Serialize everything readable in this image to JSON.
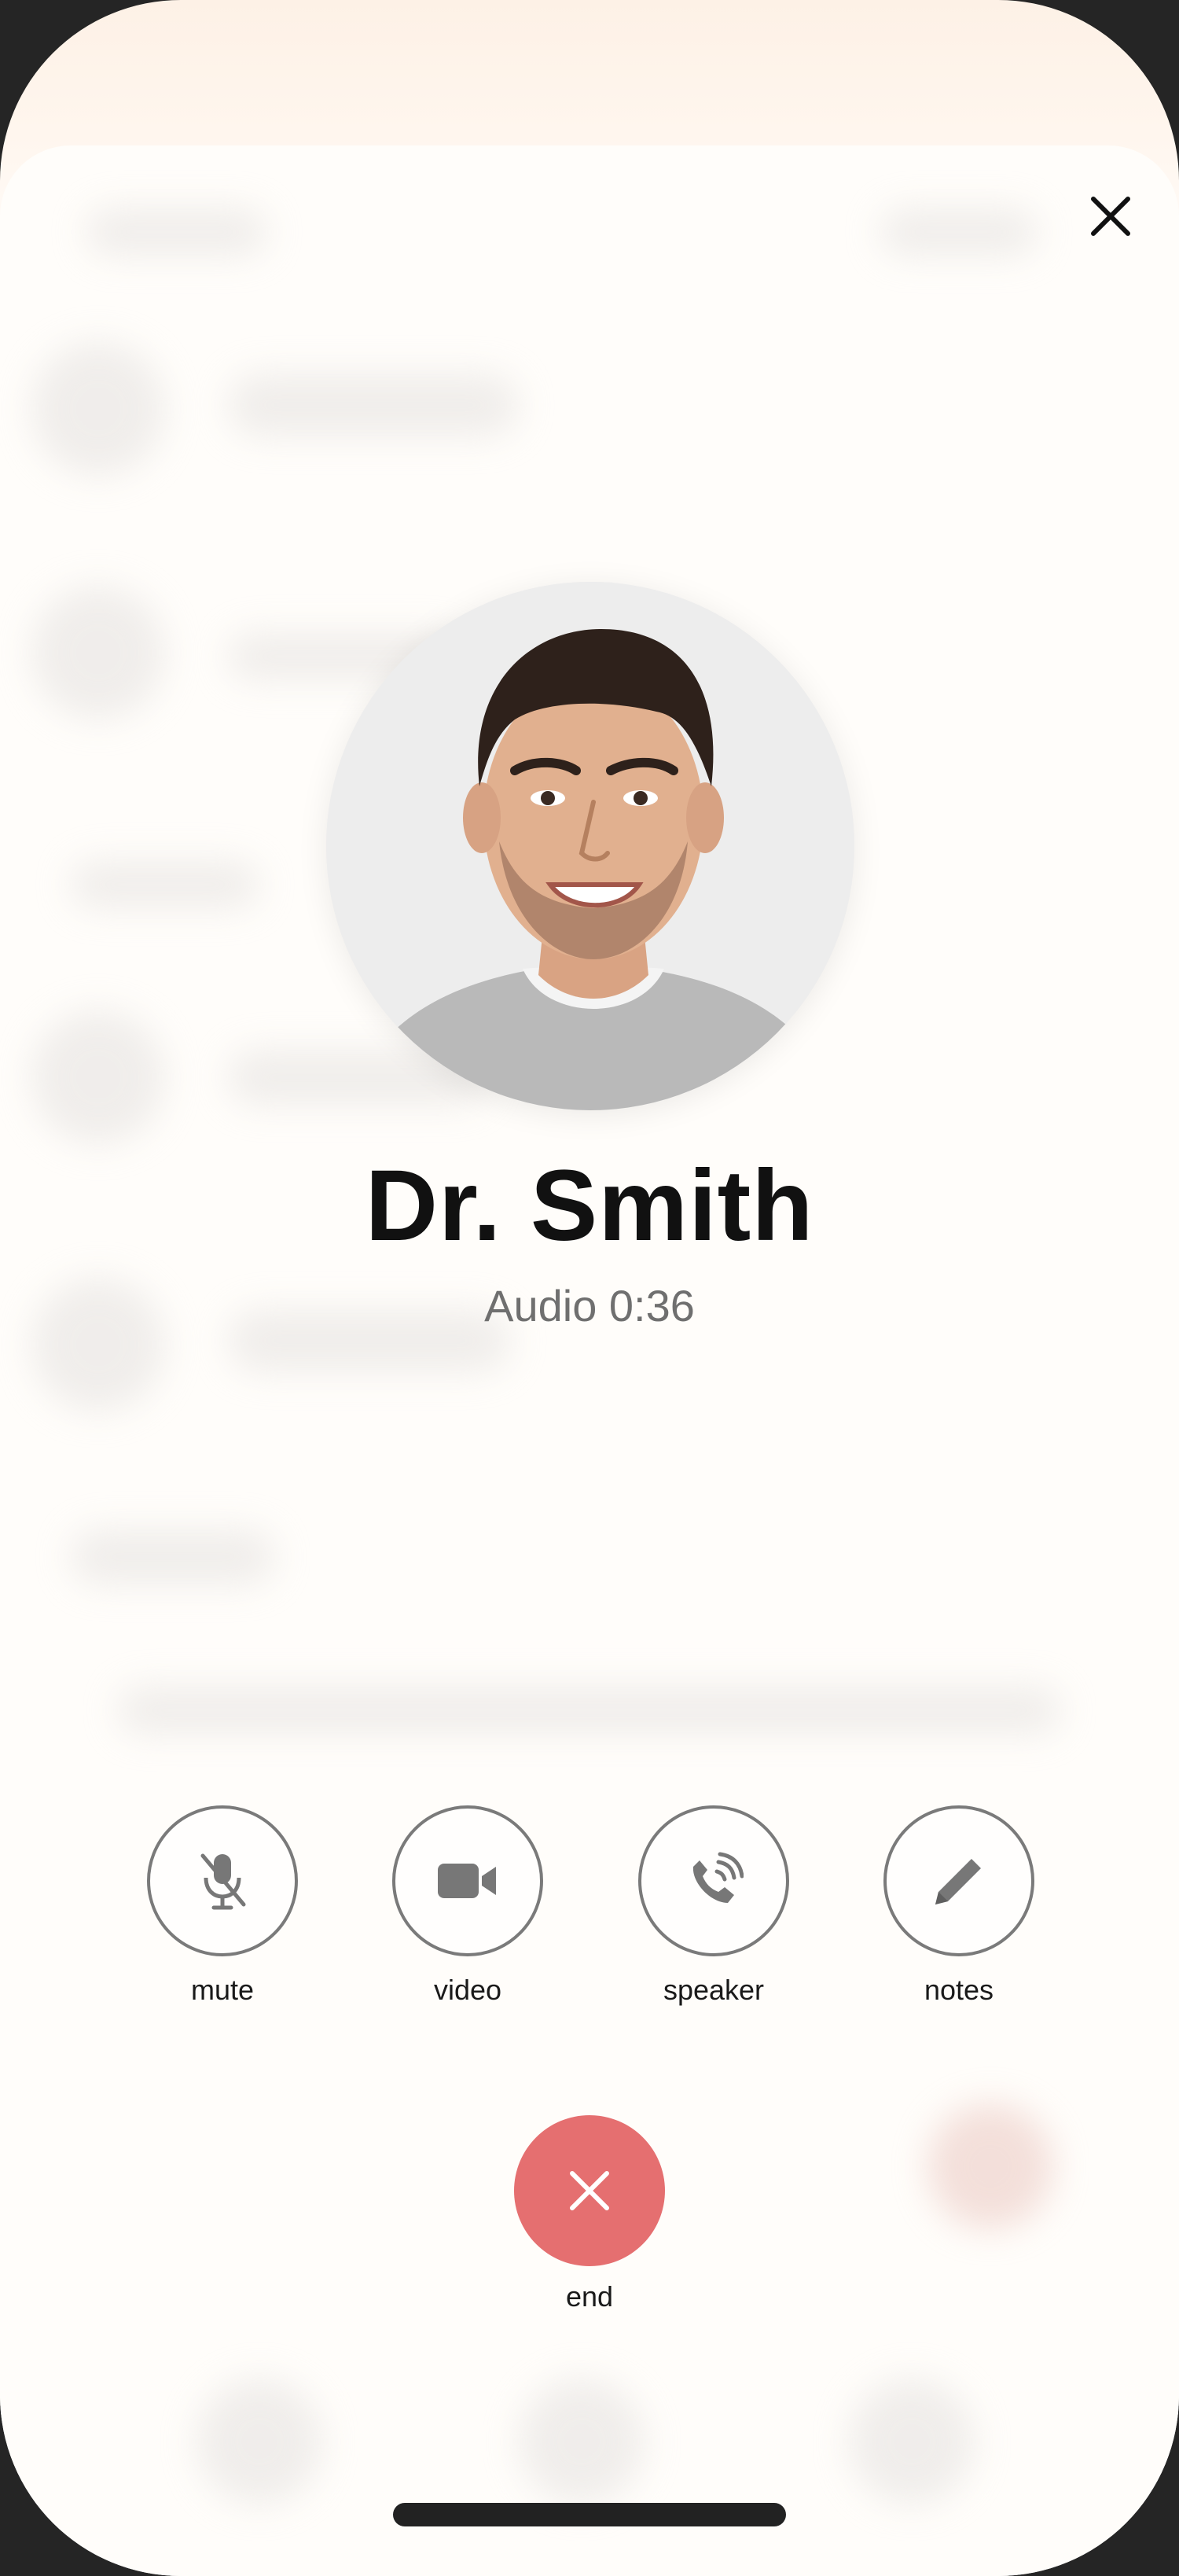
{
  "call": {
    "caller_name": "Dr. Smith",
    "status": "Audio 0:36"
  },
  "controls": [
    {
      "id": "mute",
      "label": "mute",
      "icon": "mic-off-icon"
    },
    {
      "id": "video",
      "label": "video",
      "icon": "video-camera-icon"
    },
    {
      "id": "speaker",
      "label": "speaker",
      "icon": "speaker-phone-icon"
    },
    {
      "id": "notes",
      "label": "notes",
      "icon": "pencil-icon"
    }
  ],
  "end_call": {
    "label": "end",
    "icon": "close-icon"
  },
  "colors": {
    "end_button": "#e56f70",
    "control_border": "#7a7a7a",
    "name_text": "#111111",
    "status_text": "#6f6f6f"
  }
}
